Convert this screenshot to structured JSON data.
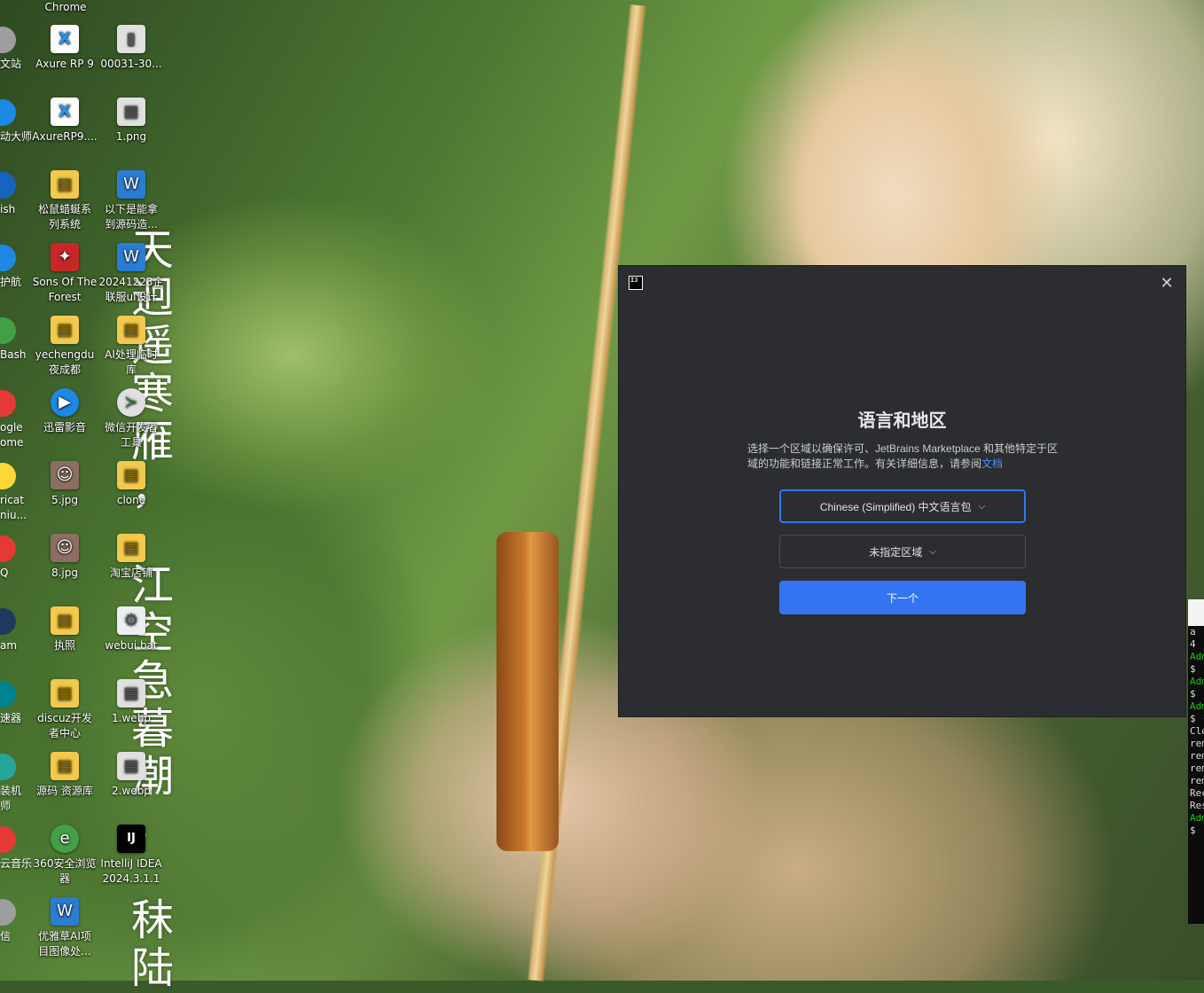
{
  "desktop": {
    "top_label": "Chrome",
    "edge_labels": [
      "文站",
      "动大师",
      "ish",
      "护航",
      "Bash",
      "ogle\nome",
      "ricat\nniu...",
      "Q",
      "am",
      "速器",
      "装机\n师",
      "云音乐",
      "信"
    ],
    "column1": [
      {
        "label": "Axure RP 9",
        "icon": "axure-icon",
        "glyph": "X"
      },
      {
        "label": "AxureRP9....",
        "icon": "axure-icon",
        "glyph": "X"
      },
      {
        "label": "松鼠蜡蜒系\n列系统",
        "icon": "folder-shortcut-icon",
        "glyph": "▤"
      },
      {
        "label": "Sons Of The\nForest",
        "icon": "game-icon",
        "glyph": "✦"
      },
      {
        "label": "yechengdu\n夜成都",
        "icon": "folder-shortcut-icon",
        "glyph": "▤"
      },
      {
        "label": "迅雷影音",
        "icon": "media-player-icon",
        "glyph": "▶"
      },
      {
        "label": "5.jpg",
        "icon": "photo-icon",
        "glyph": "☺"
      },
      {
        "label": "8.jpg",
        "icon": "photo-icon",
        "glyph": "☺"
      },
      {
        "label": "执照",
        "icon": "folder-shortcut-icon",
        "glyph": "▤"
      },
      {
        "label": "discuz开发\n者中心",
        "icon": "folder-shortcut-icon",
        "glyph": "▤"
      },
      {
        "label": "源码 资源库",
        "icon": "folder-shortcut-icon",
        "glyph": "▤"
      },
      {
        "label": "360安全浏览\n器",
        "icon": "browser-icon",
        "glyph": "e"
      },
      {
        "label": "优雅草AI项\n目图像处...",
        "icon": "word-doc-icon",
        "glyph": "W"
      }
    ],
    "column2": [
      {
        "label": "00031-30...",
        "icon": "image-file-icon",
        "glyph": "▮"
      },
      {
        "label": "1.png",
        "icon": "image-file-icon",
        "glyph": "▦"
      },
      {
        "label": "以下是能拿\n到源码造...",
        "icon": "word-doc-icon",
        "glyph": "W"
      },
      {
        "label": "20241223企\n联服ui设计",
        "icon": "word-doc-icon",
        "glyph": "W"
      },
      {
        "label": "AI处理临时\n库",
        "icon": "folder-shortcut-icon",
        "glyph": "▤"
      },
      {
        "label": "微信开发者\n工具",
        "icon": "wechat-devtools-icon",
        "glyph": "≻"
      },
      {
        "label": "clone",
        "icon": "folder-shortcut-icon",
        "glyph": "▤"
      },
      {
        "label": "淘宝店铺",
        "icon": "folder-shortcut-icon",
        "glyph": "▤"
      },
      {
        "label": "webui.bat",
        "icon": "batch-file-icon",
        "glyph": "⚙"
      },
      {
        "label": "1.webp",
        "icon": "image-file-icon",
        "glyph": "▦"
      },
      {
        "label": "2.webp",
        "icon": "image-file-icon",
        "glyph": "▦"
      },
      {
        "label": "IntelliJ IDEA\n2024.3.1.1",
        "icon": "intellij-idea-icon",
        "glyph": "IJ"
      }
    ],
    "calligraphy": "天\n迥\n遥\n寒\n雁\n，\n\n江\n空\n急\n暮\n潮\n。\n\n秣\n陆"
  },
  "terminal": {
    "lines": [
      {
        "text": "a",
        "green": false
      },
      {
        "text": "4",
        "green": false
      },
      {
        "text": "",
        "green": false
      },
      {
        "text": "Adm",
        "green": true
      },
      {
        "text": "$",
        "green": false
      },
      {
        "text": "",
        "green": false
      },
      {
        "text": "Adm",
        "green": true
      },
      {
        "text": "$",
        "green": false
      },
      {
        "text": "",
        "green": false
      },
      {
        "text": "Adm",
        "green": true
      },
      {
        "text": "$ ·",
        "green": false
      },
      {
        "text": "Clo",
        "green": false
      },
      {
        "text": "",
        "green": false
      },
      {
        "text": "",
        "green": false
      },
      {
        "text": "",
        "green": false
      },
      {
        "text": "rem",
        "green": false
      },
      {
        "text": "rem",
        "green": false
      },
      {
        "text": "rem",
        "green": false
      },
      {
        "text": "rem",
        "green": false
      },
      {
        "text": "Rec",
        "green": false
      },
      {
        "text": "Res",
        "green": false
      },
      {
        "text": "",
        "green": false
      },
      {
        "text": "Adm",
        "green": true
      },
      {
        "text": "$",
        "green": false
      }
    ]
  },
  "dialog": {
    "app_icon_text": "IJ",
    "close_glyph": "✕",
    "title": "语言和地区",
    "description": "选择一个区域以确保许可、JetBrains Marketplace 和其他特定于区域的功能和链接正常工作。有关详细信息，请参阅",
    "description_link": "文档",
    "language_select": "Chinese (Simplified) 中文语言包",
    "region_select": "未指定区域",
    "chevron_glyph": "⌵",
    "next_button": "下一个",
    "colors": {
      "background": "#2b2d30",
      "accent": "#3574f0",
      "link": "#548af7"
    }
  }
}
